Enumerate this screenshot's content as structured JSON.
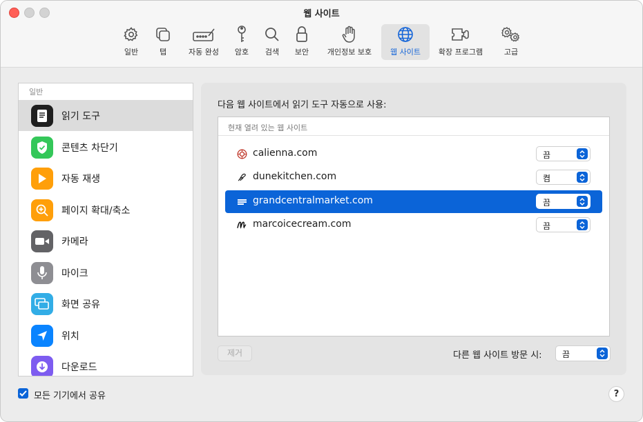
{
  "window": {
    "title": "웹 사이트"
  },
  "toolbar": {
    "items": [
      {
        "label": "일반",
        "icon": "gear-icon"
      },
      {
        "label": "탭",
        "icon": "tabs-icon"
      },
      {
        "label": "자동 완성",
        "icon": "autofill-icon"
      },
      {
        "label": "암호",
        "icon": "key-icon"
      },
      {
        "label": "검색",
        "icon": "search-icon"
      },
      {
        "label": "보안",
        "icon": "lock-icon"
      },
      {
        "label": "개인정보 보호",
        "icon": "hand-icon"
      },
      {
        "label": "웹 사이트",
        "icon": "globe-icon",
        "selected": true
      },
      {
        "label": "확장 프로그램",
        "icon": "puzzle-icon"
      },
      {
        "label": "고급",
        "icon": "gears-icon"
      }
    ]
  },
  "sidebar": {
    "header": "일반",
    "items": [
      {
        "label": "읽기 도구",
        "icon": "reader-icon",
        "color": "#1f1f1f",
        "selected": true
      },
      {
        "label": "콘텐츠 차단기",
        "icon": "shield-check-icon",
        "color": "#34c759"
      },
      {
        "label": "자동 재생",
        "icon": "play-icon",
        "color": "#ff9f0a"
      },
      {
        "label": "페이지 확대/축소",
        "icon": "zoom-icon",
        "color": "#ff9f0a"
      },
      {
        "label": "카메라",
        "icon": "camera-icon",
        "color": "#636366"
      },
      {
        "label": "마이크",
        "icon": "microphone-icon",
        "color": "#8e8e93"
      },
      {
        "label": "화면 공유",
        "icon": "screen-share-icon",
        "color": "#32ade6"
      },
      {
        "label": "위치",
        "icon": "location-icon",
        "color": "#0a84ff"
      },
      {
        "label": "다운로드",
        "icon": "download-icon",
        "color": "#7d5cf0"
      }
    ]
  },
  "main": {
    "title": "다음 웹 사이트에서 읽기 도구 자동으로 사용:",
    "table_header": "현재 열려 있는 웹 사이트",
    "rows": [
      {
        "domain": "calienna.com",
        "setting": "끔",
        "favicon": "calienna-favicon"
      },
      {
        "domain": "dunekitchen.com",
        "setting": "켬",
        "favicon": "dunekitchen-favicon"
      },
      {
        "domain": "grandcentralmarket.com",
        "setting": "끔",
        "favicon": "grandcentral-favicon",
        "selected": true
      },
      {
        "domain": "marcoicecream.com",
        "setting": "끔",
        "favicon": "marco-favicon"
      }
    ],
    "remove_label": "제거",
    "other_label": "다른 웹 사이트 방문 시:",
    "other_value": "끔"
  },
  "footer": {
    "share_label": "모든 기기에서 공유",
    "share_checked": true,
    "help_label": "?"
  },
  "colors": {
    "accent": "#0b64d8",
    "close": "#ff5f57"
  }
}
